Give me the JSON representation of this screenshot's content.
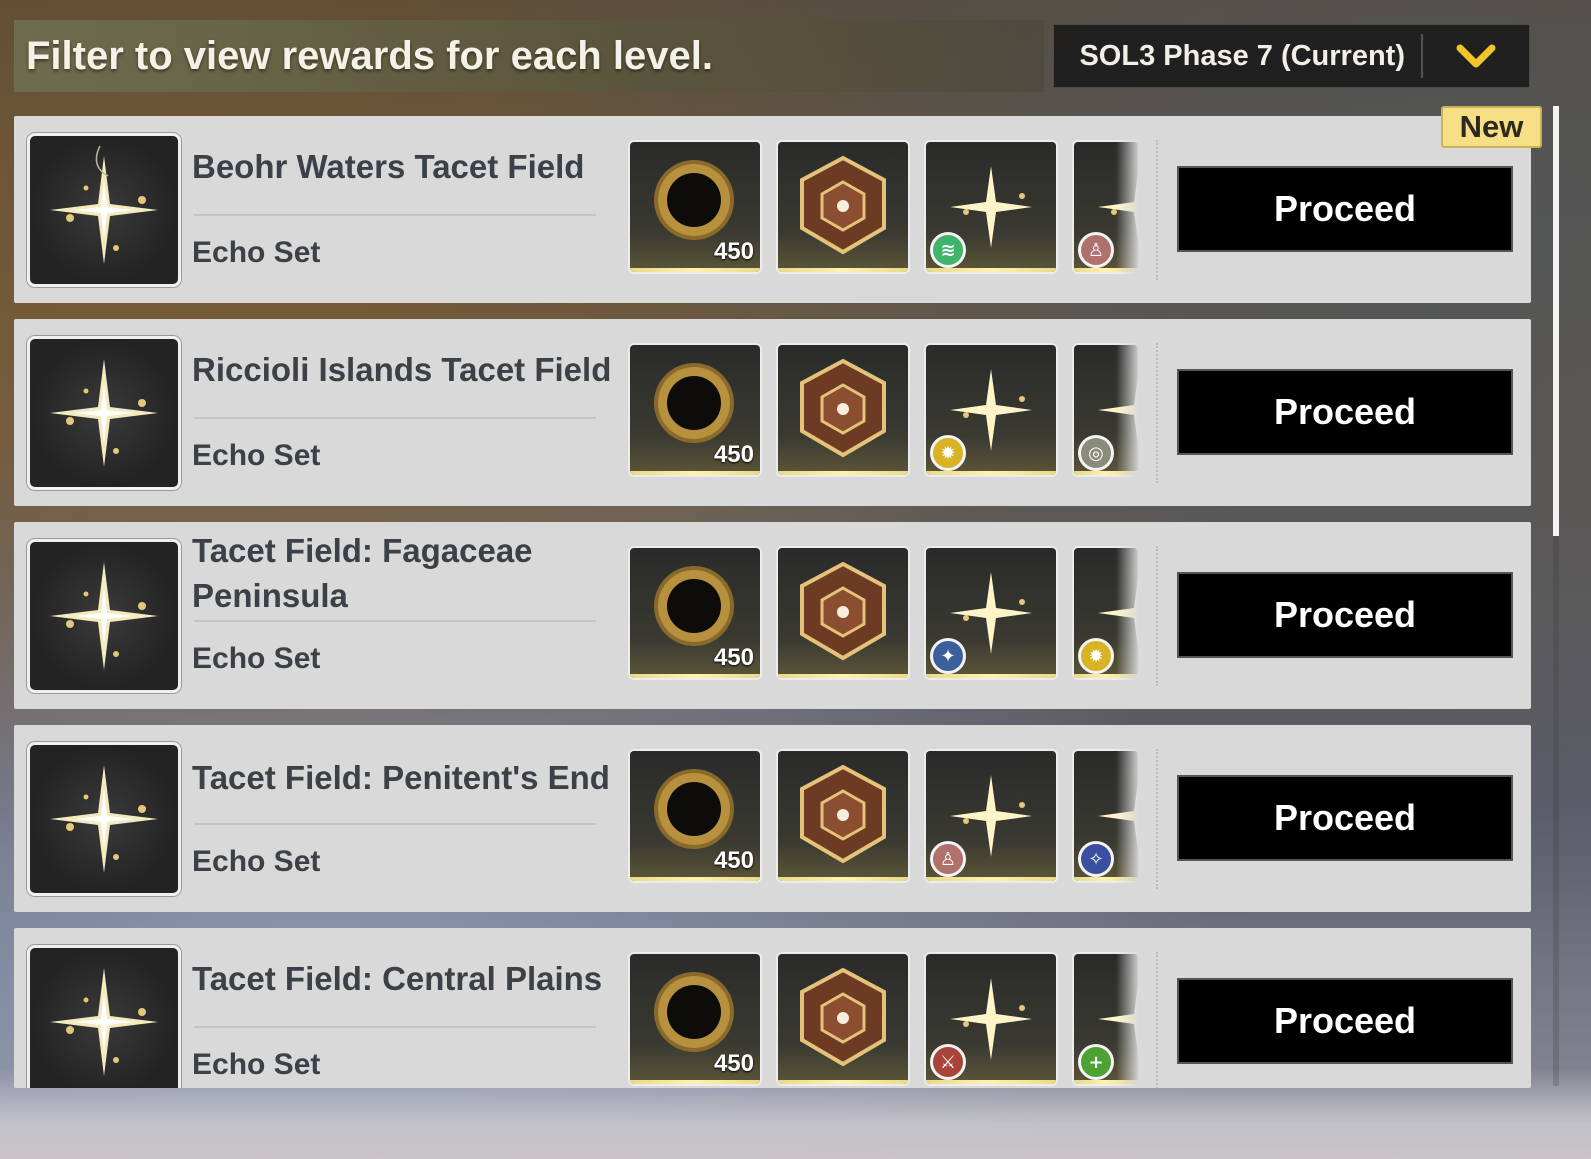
{
  "header": {
    "title": "Filter to view rewards for each level.",
    "phase_selected": "SOL3 Phase 7 (Current)"
  },
  "new_label": "New",
  "rows": [
    {
      "title": "Beohr Waters Tacet Field",
      "subtitle": "Echo Set",
      "reward_count": "450",
      "badges": [
        "wind-sigil-icon",
        "figure-icon"
      ],
      "badge_colors": [
        "#3fb46a",
        "#b0716c"
      ],
      "proceed": "Proceed"
    },
    {
      "title": "Riccioli Islands Tacet Field",
      "subtitle": "Echo Set",
      "reward_count": "450",
      "badges": [
        "sun-gear-icon",
        "spiral-target-icon"
      ],
      "badge_colors": [
        "#d8b324",
        "#8b8b7c"
      ],
      "proceed": "Proceed"
    },
    {
      "title": "Tacet Field: Fagaceae Peninsula",
      "subtitle": "Echo Set",
      "reward_count": "450",
      "badges": [
        "compass-star-icon",
        "sun-gear-icon"
      ],
      "badge_colors": [
        "#3d5f9e",
        "#d8b324"
      ],
      "proceed": "Proceed"
    },
    {
      "title": "Tacet Field: Penitent's End",
      "subtitle": "Echo Set",
      "reward_count": "450",
      "badges": [
        "figure-icon",
        "sparkle-star-icon"
      ],
      "badge_colors": [
        "#b0716c",
        "#3a4fa0"
      ],
      "proceed": "Proceed"
    },
    {
      "title": "Tacet Field: Central Plains",
      "subtitle": "Echo Set",
      "reward_count": "450",
      "badges": [
        "crossed-swords-icon",
        "plus-heal-icon"
      ],
      "badge_colors": [
        "#a8443a",
        "#4ea234"
      ],
      "proceed": "Proceed"
    }
  ]
}
